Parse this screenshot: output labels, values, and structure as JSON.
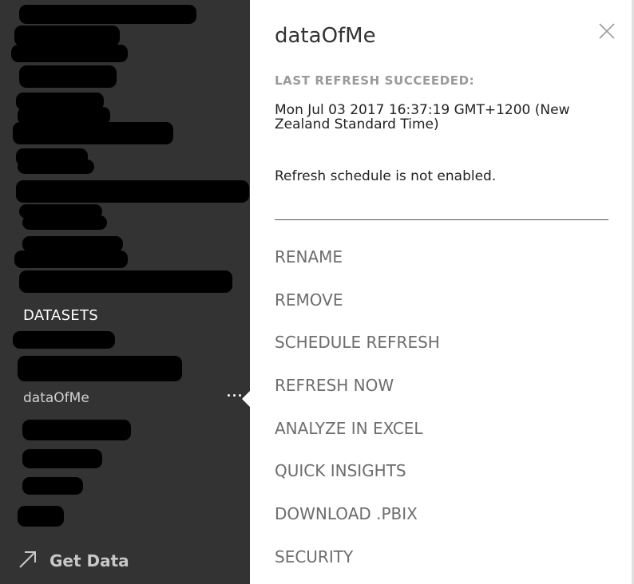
{
  "sidebar": {
    "datasets_heading": "DATASETS",
    "selected_dataset": "dataOfMe",
    "more_options": "···",
    "get_data_label": "Get Data"
  },
  "panel": {
    "title": "dataOfMe",
    "refresh_status_label": "LAST REFRESH SUCCEEDED:",
    "refresh_time": "Mon Jul 03 2017 16:37:19 GMT+1200 (New Zealand Standard Time)",
    "schedule_status": "Refresh schedule is not enabled.",
    "menu": [
      {
        "label": "RENAME"
      },
      {
        "label": "REMOVE"
      },
      {
        "label": "SCHEDULE REFRESH"
      },
      {
        "label": "REFRESH NOW"
      },
      {
        "label": "ANALYZE IN EXCEL"
      },
      {
        "label": "QUICK INSIGHTS"
      },
      {
        "label": "DOWNLOAD .PBIX"
      },
      {
        "label": "SECURITY"
      }
    ]
  },
  "colors": {
    "sidebar_bg": "#333333",
    "panel_bg": "#ffffff",
    "menu_text": "#6d6d6d",
    "status_label": "#9a9a9a"
  }
}
